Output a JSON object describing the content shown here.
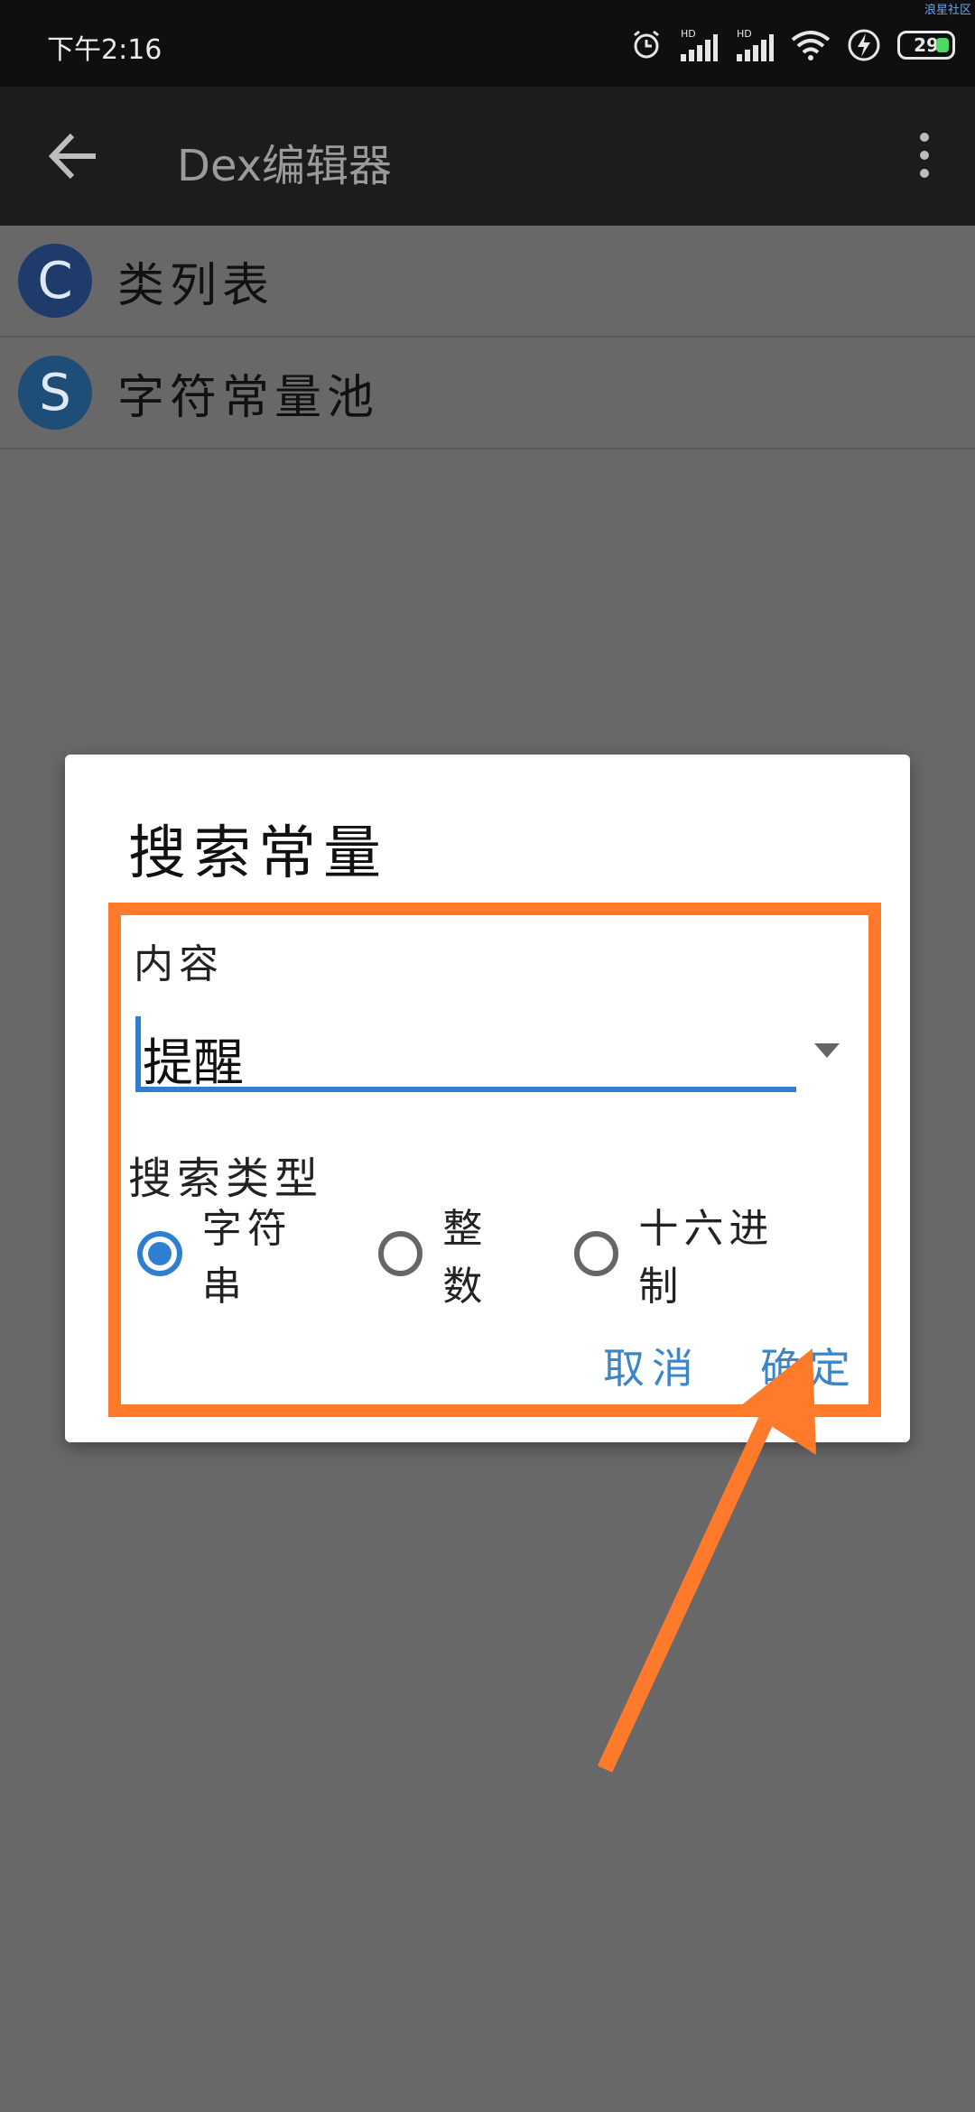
{
  "status_bar": {
    "time": "下午2:16",
    "battery": "29",
    "watermark": "浪星社区",
    "icons": [
      "alarm-icon",
      "signal-hd-icon",
      "signal-hd-icon",
      "wifi-icon",
      "charging-icon",
      "battery-icon"
    ]
  },
  "app_bar": {
    "title": "Dex编辑器",
    "icons": [
      "back-arrow-icon",
      "more-vert-icon"
    ]
  },
  "list": {
    "items": [
      {
        "avatar": "C",
        "label": "类列表",
        "color": "#1e3b6c"
      },
      {
        "avatar": "S",
        "label": "字符常量池",
        "color": "#1e4e78"
      }
    ]
  },
  "dialog": {
    "title": "搜索常量",
    "content_label": "内容",
    "content_value": "提醒",
    "search_type_label": "搜索类型",
    "radio_options": [
      "字符串",
      "整数",
      "十六进制"
    ],
    "selected_option": "字符串",
    "cancel_label": "取消",
    "ok_label": "确定"
  },
  "colors": {
    "accent": "#2f7fd0",
    "annotation": "#ff7a2b",
    "overlay": "#686868"
  }
}
